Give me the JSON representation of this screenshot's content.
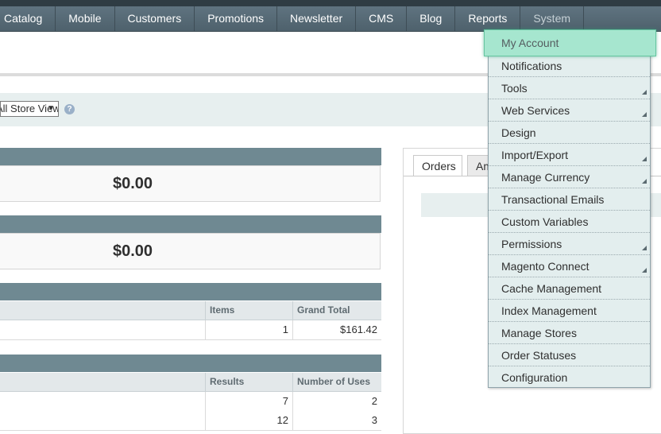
{
  "nav": {
    "items": [
      "Catalog",
      "Mobile",
      "Customers",
      "Promotions",
      "Newsletter",
      "CMS",
      "Blog",
      "Reports",
      "System"
    ]
  },
  "scope": {
    "selected": "All Store Views",
    "help": "?"
  },
  "panels": {
    "amount_1": "$0.00",
    "amount_2": "$0.00"
  },
  "grid1": {
    "headers": [
      "Items",
      "Grand Total"
    ],
    "row": [
      "1",
      "$161.42"
    ]
  },
  "grid2": {
    "headers": [
      "Results",
      "Number of Uses"
    ],
    "rows": [
      [
        "7",
        "2"
      ],
      [
        "12",
        "3"
      ]
    ]
  },
  "tabs": [
    "Orders",
    "Amounts"
  ],
  "system_menu": {
    "hovered": "My Account",
    "items": [
      {
        "label": "Notifications",
        "submenu": false
      },
      {
        "label": "Tools",
        "submenu": true
      },
      {
        "label": "Web Services",
        "submenu": true
      },
      {
        "label": "Design",
        "submenu": false
      },
      {
        "label": "Import/Export",
        "submenu": true
      },
      {
        "label": "Manage Currency",
        "submenu": true
      },
      {
        "label": "Transactional Emails",
        "submenu": false
      },
      {
        "label": "Custom Variables",
        "submenu": false
      },
      {
        "label": "Permissions",
        "submenu": true
      },
      {
        "label": "Magento Connect",
        "submenu": true
      },
      {
        "label": "Cache Management",
        "submenu": false
      },
      {
        "label": "Index Management",
        "submenu": false
      },
      {
        "label": "Manage Stores",
        "submenu": false
      },
      {
        "label": "Order Statuses",
        "submenu": false
      },
      {
        "label": "Configuration",
        "submenu": false
      }
    ]
  },
  "colors": {
    "nav_bg": "#5f7380",
    "hover": "#a6e6cf",
    "menu_bg": "#e3eeee",
    "panel_head": "#6f8992"
  }
}
